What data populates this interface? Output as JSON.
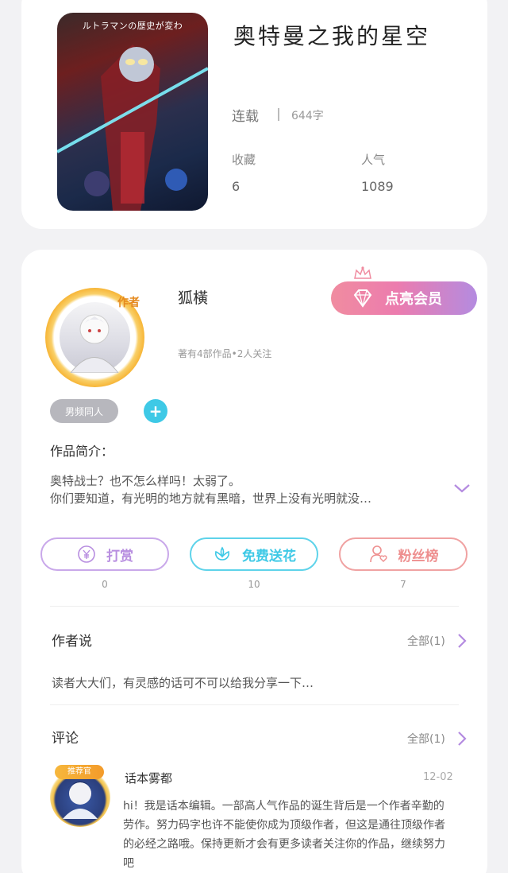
{
  "book": {
    "cover_caption": "ルトラマンの歴史が変わ",
    "title": "奥特曼之我的星空",
    "status": "连载",
    "word_count": "644字",
    "favorites_label": "收藏",
    "favorites_value": "6",
    "popularity_label": "人气",
    "popularity_value": "1089"
  },
  "author": {
    "badge": "作者",
    "name": "狐橫",
    "meta": "著有4部作品•2人关注",
    "vip_button": "点亮会员",
    "tag": "男频同人",
    "add_tag": "+",
    "intro_label": "作品简介：",
    "intro_lines": [
      "奥特战士？也不怎么样吗！太弱了。",
      "你们要知道，有光明的地方就有黑暗，世界上没有光明就没…"
    ]
  },
  "actions": [
    {
      "label": "打赏",
      "count": "0",
      "color": "#b88ee0"
    },
    {
      "label": "免费送花",
      "count": "10",
      "color": "#3ec9e6"
    },
    {
      "label": "粉丝榜",
      "count": "7",
      "color": "#ee8f8f"
    }
  ],
  "author_says": {
    "title": "作者说",
    "all_link": "全部(1)",
    "text": "读者大大们，有灵感的话可不可以给我分享一下…"
  },
  "comments": {
    "title": "评论",
    "all_link": "全部(1)",
    "items": [
      {
        "badge": "推荐官",
        "name": "话本雾都",
        "date": "12-02",
        "text": "hi！我是话本编辑。一部高人气作品的诞生背后是一个作者辛勤的劳作。努力码字也许不能使你成为顶级作者，但这是通往顶级作者的必经之路哦。保持更新才会有更多读者关注你的作品，继续努力吧"
      }
    ]
  },
  "colors": {
    "vip_gradient_start": "#f08ca0",
    "vip_gradient_end": "#b48be0",
    "accent_cyan": "#3ec9e6",
    "chevron": "#b48be0"
  }
}
